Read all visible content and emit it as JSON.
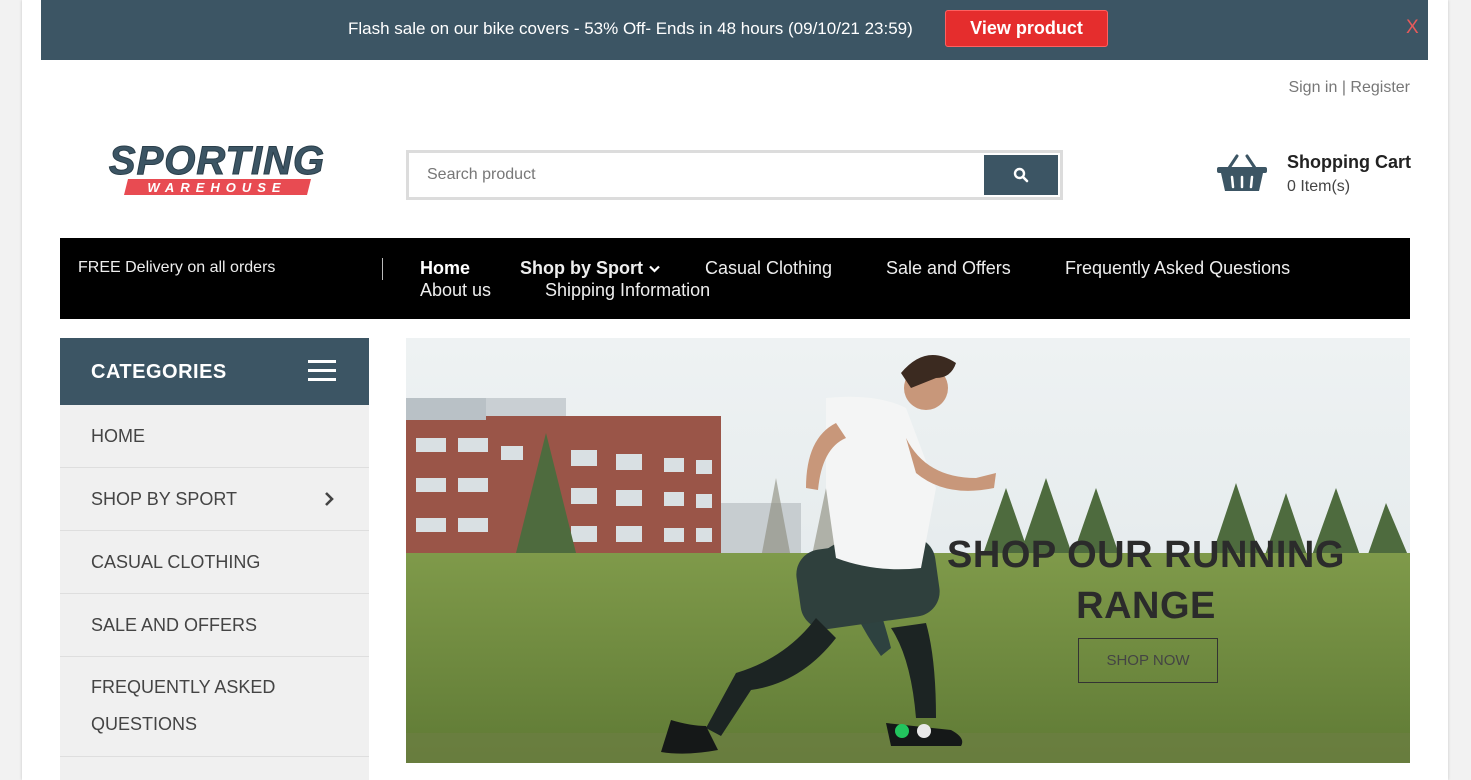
{
  "promo": {
    "text": "Flash sale on our bike covers - 53% Off- Ends in 48 hours (09/10/21 23:59)",
    "button": "View product",
    "close": "X"
  },
  "account": {
    "sign_in": "Sign in",
    "separator": "|",
    "register": "Register"
  },
  "logo": {
    "line1": "SPORTING",
    "line2": "WAREHOUSE"
  },
  "search": {
    "placeholder": "Search product",
    "icon": "search-icon"
  },
  "cart": {
    "title": "Shopping Cart",
    "count": "0 Item(s)",
    "icon": "basket-icon"
  },
  "nav": {
    "delivery": "FREE Delivery on all orders",
    "items": [
      {
        "label": "Home"
      },
      {
        "label": "Shop by Sport"
      },
      {
        "label": "Casual Clothing"
      },
      {
        "label": "Sale and Offers"
      },
      {
        "label": "Frequently Asked Questions"
      },
      {
        "label": "About us"
      },
      {
        "label": "Shipping Information"
      }
    ]
  },
  "categories": {
    "title": "CATEGORIES",
    "items": [
      {
        "label": "HOME"
      },
      {
        "label": "SHOP BY SPORT"
      },
      {
        "label": "CASUAL CLOTHING"
      },
      {
        "label": "SALE AND OFFERS"
      },
      {
        "label": "FREQUENTLY ASKED QUESTIONS"
      }
    ]
  },
  "hero": {
    "title": "SHOP OUR RUNNING RANGE",
    "button": "SHOP NOW",
    "slides": 2,
    "active_slide": 1
  },
  "colors": {
    "brand": "#3c5564",
    "promo_button": "#e52d2d",
    "nav_bg": "#000000",
    "dot_active": "#22c55e",
    "logo_red": "#e84b52"
  }
}
